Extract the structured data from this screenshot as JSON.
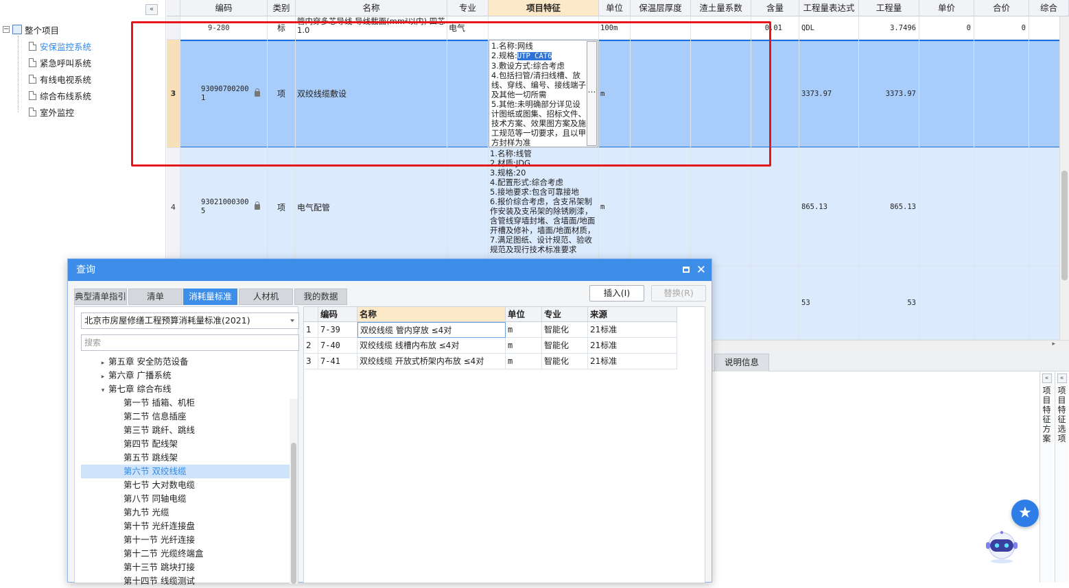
{
  "tree": {
    "root": "整个项目",
    "items": [
      "安保监控系统",
      "紧急呼叫系统",
      "有线电视系统",
      "综合布线系统",
      "室外监控"
    ],
    "selected_index": 0
  },
  "grid": {
    "headers": [
      "编码",
      "类别",
      "名称",
      "专业",
      "项目特征",
      "单位",
      "保温层厚度",
      "渣土量系数",
      "含量",
      "工程量表达式",
      "工程量",
      "单价",
      "合价",
      "综合"
    ],
    "rows": [
      {
        "num": "",
        "code": "9-280",
        "type": "标",
        "name": "管内穿多芯导线 导线截面(mm²以内) 四芯 1.0",
        "major": "电气",
        "feature": "",
        "unit": "100m",
        "content": "0.01",
        "expr": "QDL",
        "qty": "3.7496",
        "price": "0",
        "total": "0"
      },
      {
        "num": "3",
        "code": "930907002001",
        "type": "项",
        "name": "双绞线缆敷设",
        "major": "",
        "feature_lines": [
          "1.名称:网线",
          "2.规格:",
          "3.敷设方式:综合考虑",
          "4.包括扫管/清扫线槽、放线、穿线、编号、接线端子及其他一切所需",
          "5.其他:未明确部分详见设计图纸或图集、招标文件、技术方案、效果图方案及施工规范等一切要求，且以甲方封样为准"
        ],
        "feature_selected": "UTP CAT6",
        "unit": "m",
        "content": "",
        "expr": "3373.97",
        "qty": "3373.97",
        "price": "",
        "total": ""
      },
      {
        "num": "4",
        "code": "930210003005",
        "type": "项",
        "name": "电气配管",
        "major": "",
        "feature": "1.名称:线管\n2.材质:JDG\n3.规格:20\n4.配置形式:综合考虑\n5.接地要求:包含可靠接地\n6.报价综合考虑，含支吊架制作安装及支吊架的除锈刷漆，含管线穿墙封堵、含墙面/地面开槽及修补，墙面/地面材质，\n7.满足图纸、设计规范、验收规范及现行技术标准要求",
        "unit": "m",
        "content": "",
        "expr": "865.13",
        "qty": "865.13",
        "price": "",
        "total": ""
      },
      {
        "num": "",
        "code": "",
        "type": "",
        "name": "",
        "major": "",
        "feature": "",
        "unit": "",
        "content": "",
        "expr": "53",
        "qty": "53",
        "price": "",
        "total": ""
      }
    ]
  },
  "bottom_panel": {
    "tab": "说明信息",
    "side1": "项目特征方案",
    "side2": "项目特征选项",
    "collapse": "«"
  },
  "dialog": {
    "title": "查询",
    "tabs": [
      "典型清单指引",
      "清单",
      "消耗量标准",
      "人材机",
      "我的数据"
    ],
    "active_tab": 2,
    "insert_btn": "插入(I)",
    "replace_btn": "替换(R)",
    "standard": "北京市房屋修缮工程预算消耗量标准(2021)",
    "search_placeholder": "搜索",
    "chapters": [
      {
        "label": "第五章 安全防范设备",
        "level": 0,
        "tri": "▸"
      },
      {
        "label": "第六章 广播系统",
        "level": 0,
        "tri": "▸"
      },
      {
        "label": "第七章 综合布线",
        "level": 0,
        "tri": "▾"
      },
      {
        "label": "第一节 插箱、机柜",
        "level": 1
      },
      {
        "label": "第二节 信息插座",
        "level": 1
      },
      {
        "label": "第三节 跳纤、跳线",
        "level": 1
      },
      {
        "label": "第四节 配线架",
        "level": 1
      },
      {
        "label": "第五节 跳线架",
        "level": 1
      },
      {
        "label": "第六节 双绞线缆",
        "level": 1,
        "selected": true
      },
      {
        "label": "第七节 大对数电缆",
        "level": 1
      },
      {
        "label": "第八节 同轴电缆",
        "level": 1
      },
      {
        "label": "第九节 光缆",
        "level": 1
      },
      {
        "label": "第十节 光纤连接盘",
        "level": 1
      },
      {
        "label": "第十一节 光纤连接",
        "level": 1
      },
      {
        "label": "第十二节 光缆终端盒",
        "level": 1
      },
      {
        "label": "第十三节 跳块打接",
        "level": 1
      },
      {
        "label": "第十四节 线缆测试",
        "level": 1
      }
    ],
    "table_headers": [
      "",
      "编码",
      "名称",
      "单位",
      "专业",
      "来源"
    ],
    "table_rows": [
      [
        "1",
        "7-39",
        "双绞线缆 管内穿放 ≤4对",
        "m",
        "智能化",
        "21标准"
      ],
      [
        "2",
        "7-40",
        "双绞线缆 线槽内布放 ≤4对",
        "m",
        "智能化",
        "21标准"
      ],
      [
        "3",
        "7-41",
        "双绞线缆 开放式桥架内布放 ≤4对",
        "m",
        "智能化",
        "21标准"
      ]
    ]
  },
  "colors": {
    "accent": "#3d8ee9",
    "selected_row": "#a9cdfa",
    "highlight": "#e5151a"
  }
}
